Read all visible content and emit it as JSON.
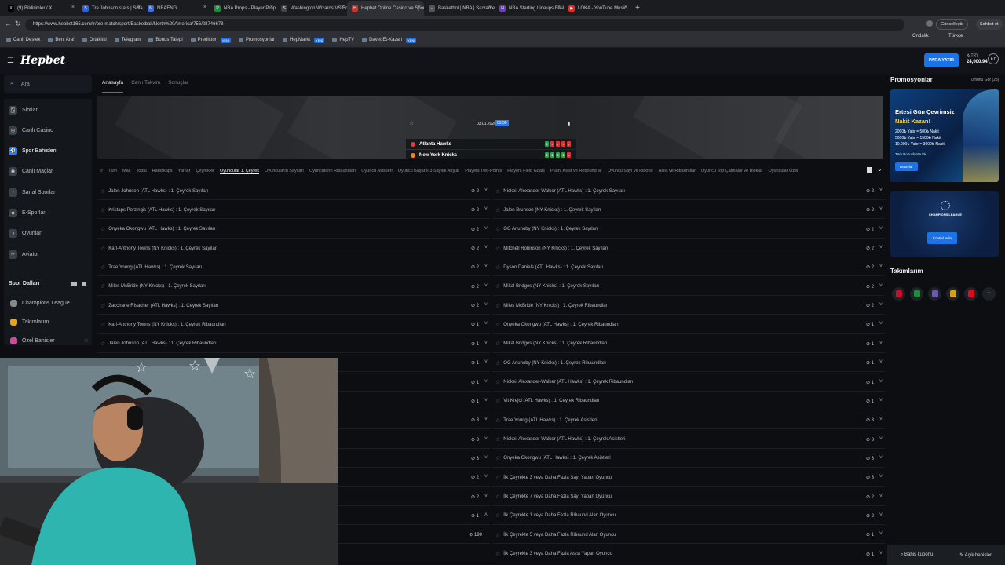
{
  "browser": {
    "tabs": [
      {
        "label": "(9) Bildirimler / X",
        "color": "#000000",
        "glyph": "X"
      },
      {
        "label": "Tre Johnson stats | Sofascore",
        "color": "#2b62d6",
        "glyph": "S"
      },
      {
        "label": "NBAENG",
        "color": "#3c6fd8",
        "glyph": "N"
      },
      {
        "label": "NBA Props - Player Prop Betting &",
        "color": "#1f8a3b",
        "glyph": "P"
      },
      {
        "label": "Washington Wizards VS Brooklyn",
        "color": "#444444",
        "glyph": "S"
      },
      {
        "label": "Hepbet Online Casino ve Spor Bah",
        "color": "#c0392b",
        "glyph": "H"
      },
      {
        "label": "Basketbol | NBA | Sacramento Kin",
        "color": "#555555",
        "glyph": "-"
      },
      {
        "label": "NBA Starting Lineups Basketball",
        "color": "#6a3fb5",
        "glyph": "N"
      },
      {
        "label": "LOKA - YouTube Music",
        "color": "#e02a2a",
        "glyph": "▶"
      }
    ],
    "active_tab": 5,
    "url": "https://www.hepbet165.com/tr/pre-match/sport/Basketball/North%20America/756/28746678",
    "update_label": "Güncelleştir",
    "chat_label": "Sohbet et"
  },
  "bookmarks": [
    {
      "label": "Canlı Destek",
      "badge": ""
    },
    {
      "label": "Beni Ara!",
      "badge": ""
    },
    {
      "label": "Ortaklıkl",
      "badge": ""
    },
    {
      "label": "Telegram",
      "badge": ""
    },
    {
      "label": "Bonus Talepi",
      "badge": ""
    },
    {
      "label": "Predictor",
      "badge": "YENİ"
    },
    {
      "label": "Promosyonlar",
      "badge": ""
    },
    {
      "label": "HepMarkt",
      "badge": "YENİ"
    },
    {
      "label": "HepTV",
      "badge": ""
    },
    {
      "label": "Davet Et-Kazan",
      "badge": "YENİ"
    }
  ],
  "header": {
    "logo": "Hepbet",
    "odds_format": "Ondalık",
    "language": "Türkçe",
    "deposit_button": "PARA YATIR",
    "currency": "₺ TRY",
    "balance": "24,000.94",
    "avatar": "EY"
  },
  "sidebar": {
    "search_placeholder": "Ara",
    "items": [
      {
        "label": "Slotlar",
        "icon": "🂡"
      },
      {
        "label": "Canlı Casino",
        "icon": "◎"
      },
      {
        "label": "Spor Bahisleri",
        "icon": "⚽"
      },
      {
        "label": "Canlı Maçlar",
        "icon": "◉"
      },
      {
        "label": "Sanal Sporlar",
        "icon": "◔"
      },
      {
        "label": "E-Sporlar",
        "icon": "◆"
      },
      {
        "label": "Oyunlar",
        "icon": "◑"
      },
      {
        "label": "Aviator",
        "icon": "✈"
      }
    ],
    "sports_title": "Spor Dalları",
    "sports": [
      {
        "label": "Champions League",
        "color": "#888888"
      },
      {
        "label": "Takımlarım",
        "color": "#e8a21b"
      },
      {
        "label": "Özel Bahisler",
        "color": "#d04ba0"
      }
    ]
  },
  "main": {
    "subtabs": [
      "Anasayfa",
      "Canlı Takvim",
      "Sonuçlar"
    ],
    "match": {
      "date": "03.01.2026",
      "time": "03:30",
      "home": "Atlanta Hawks",
      "away": "New York Knicks",
      "home_score": [
        "0",
        "-",
        "-",
        "-",
        "-"
      ],
      "away_score": [
        "0",
        "0",
        "0",
        "0",
        "-"
      ]
    },
    "filters": [
      "Tüm",
      "Maç",
      "Toplu",
      "Handikaps",
      "Yarılar",
      "Çeyrekler",
      "Oyuncular 1. Çeyrek",
      "Oyuncuların Sayıları",
      "Oyuncuların Ribaundları",
      "Oyuncu Asistleri",
      "Oyuncu Başarılı 3 Sayılık Atışlar",
      "Players Two-Points",
      "Players Field Goals",
      "Puan, Asist ve Rebound'lar",
      "Oyuncu Sayı ve Ribond",
      "Asist ve Ribaundlar",
      "Oyuncu Top Çalmalar ve Bloklar",
      "Oyuncular Özel"
    ],
    "active_filter": 6,
    "left_rows": [
      {
        "label": "Jalen Johnson (ATL Hawks) : 1. Çeyrek Sayıları",
        "count": "2"
      },
      {
        "label": "Kristaps Porzingis (ATL Hawks) : 1. Çeyrek Sayıları",
        "count": "2"
      },
      {
        "label": "Onyeka Okongwu (ATL Hawks) : 1. Çeyrek Sayıları",
        "count": "2"
      },
      {
        "label": "Karl-Anthony Towns (NY Knicks) : 1. Çeyrek Sayıları",
        "count": "2"
      },
      {
        "label": "Trae Young (ATL Hawks) : 1. Çeyrek Sayıları",
        "count": "2"
      },
      {
        "label": "Miles McBride (NY Knicks) : 1. Çeyrek Sayıları",
        "count": "2"
      },
      {
        "label": "Zaccharie Risacher (ATL Hawks) : 1. Çeyrek Sayıları",
        "count": "2"
      },
      {
        "label": "Karl-Anthony Towns (NY Knicks) : 1. Çeyrek Ribaundları",
        "count": "1"
      },
      {
        "label": "Jalen Johnson (ATL Hawks) : 1. Çeyrek Ribaundları",
        "count": "1"
      },
      {
        "label": "",
        "count": "1"
      },
      {
        "label": "",
        "count": "1"
      },
      {
        "label": "",
        "count": "1"
      },
      {
        "label": "",
        "count": "3"
      },
      {
        "label": "",
        "count": "3"
      },
      {
        "label": "",
        "count": "3"
      },
      {
        "label": "",
        "count": "2"
      },
      {
        "label": "",
        "count": "2"
      },
      {
        "label": "",
        "count": "1"
      },
      {
        "label": "",
        "count": "190"
      }
    ],
    "right_rows": [
      {
        "label": "Nickeil Alexander-Walker (ATL Hawks) : 1. Çeyrek Sayıları",
        "count": "2"
      },
      {
        "label": "Jalen Brunson (NY Knicks) : 1. Çeyrek Sayıları",
        "count": "2"
      },
      {
        "label": "OG Anunoby (NY Knicks) : 1. Çeyrek Sayıları",
        "count": "2"
      },
      {
        "label": "Mitchell Robinson (NY Knicks) : 1. Çeyrek Sayıları",
        "count": "2"
      },
      {
        "label": "Dyson Daniels (ATL Hawks) : 1. Çeyrek Sayıları",
        "count": "2"
      },
      {
        "label": "Mikal Bridges (NY Knicks) : 1. Çeyrek Sayıları",
        "count": "2"
      },
      {
        "label": "Miles McBride (NY Knicks) : 1. Çeyrek Ribaundları",
        "count": "2"
      },
      {
        "label": "Onyeka Okongwu (ATL Hawks) : 1. Çeyrek Ribaundları",
        "count": "1"
      },
      {
        "label": "Mikal Bridges (NY Knicks) : 1. Çeyrek Ribaundları",
        "count": "1"
      },
      {
        "label": "OG Anunoby (NY Knicks) : 1. Çeyrek Ribaundları",
        "count": "1"
      },
      {
        "label": "Nickeil Alexander-Walker (ATL Hawks) : 1. Çeyrek Ribaundları",
        "count": "1"
      },
      {
        "label": "Vit Krejci (ATL Hawks) : 1. Çeyrek Ribaundları",
        "count": "1"
      },
      {
        "label": "Trae Young (ATL Hawks) : 1. Çeyrek Asistleri",
        "count": "3"
      },
      {
        "label": "Nickeil Alexander-Walker (ATL Hawks) : 1. Çeyrek Asistleri",
        "count": "3"
      },
      {
        "label": "Onyeka Okongwu (ATL Hawks) : 1. Çeyrek Asistleri",
        "count": "3"
      },
      {
        "label": "İlk Çeyrekte 3 veya Daha Fazla Sayı Yapan Oyuncu",
        "count": "3"
      },
      {
        "label": "İlk Çeyrekte 7 veya Daha Fazla Sayı Yapan Oyuncu",
        "count": "2"
      },
      {
        "label": "İlk Çeyrekte 1 veya Daha Fazla Ribaund Alan Oyuncu",
        "count": "2"
      },
      {
        "label": "İlk Çeyrekte 5 veya Daha Fazla Ribaund Alan Oyuncu",
        "count": "1"
      },
      {
        "label": "İlk Çeyrekte 3 veya Daha Fazla Asist Yapan Oyuncu",
        "count": "1"
      }
    ]
  },
  "right": {
    "promo_title": "Promosyonlar",
    "see_all": "Tümünü Gör (23)",
    "promo1": {
      "title": "Ertesi Gün Çevrimsiz",
      "subtitle": "Nakit Kazan!",
      "lines": [
        "2000₺ Yatır = 500₺ Nakit",
        "5000₺ Yatır = 1500₺ Nakit",
        "10.000₺ Yatır = 3000₺ Nakit"
      ],
      "footer": "Tüm Bonuslarda Ek",
      "button": "Detaylar"
    },
    "promo2": {
      "title": "CHAMPIONS LEAGUE",
      "button": "Kontrol edin"
    },
    "teams_title": "Takımlarım",
    "team_colors": [
      "#c8102e",
      "#1e8c3a",
      "#6b5bb0",
      "#d4a017",
      "#e30a17"
    ],
    "bet_slip": "Bahis kuponu",
    "open_bets": "Açık bahisler"
  }
}
